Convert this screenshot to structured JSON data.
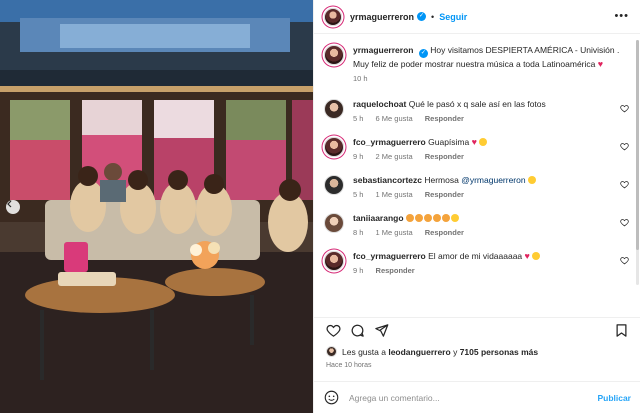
{
  "post": {
    "username": "yrmaguerreron",
    "follow_label": "Seguir",
    "dot": "•",
    "more": "•••"
  },
  "caption": {
    "username": "yrmaguerreron",
    "text": "Hoy visitamos DESPIERTA AMÉRICA - Univisión . Muy feliz de poder mostrar nuestra música a toda Latinoamérica",
    "time": "10 h"
  },
  "comments": [
    {
      "username": "raquelochoat",
      "text": "Qué le pasó x q sale así en las fotos",
      "time": "5 h",
      "likes": "6 Me gusta",
      "reply": "Responder"
    },
    {
      "username": "fco_yrmaguerrero",
      "text": "Guapísima",
      "time": "9 h",
      "likes": "2 Me gusta",
      "reply": "Responder"
    },
    {
      "username": "sebastiancortezc",
      "text": "Hermosa",
      "mention": "@yrmaguerreron",
      "time": "5 h",
      "likes": "1 Me gusta",
      "reply": "Responder"
    },
    {
      "username": "taniiaarango",
      "text": "",
      "time": "8 h",
      "likes": "1 Me gusta",
      "reply": "Responder"
    },
    {
      "username": "fco_yrmaguerrero",
      "text": "El amor de mi vidaaaaaa",
      "time": "9 h",
      "likes": "",
      "reply": "Responder"
    }
  ],
  "likes": {
    "prefix": "Les gusta a",
    "user": "leodanguerrero",
    "conj": "y",
    "count": "7105 personas más"
  },
  "posted_ago": "Hace 10 horas",
  "comment_box": {
    "placeholder": "Agrega un comentario...",
    "publish_label": "Publicar"
  },
  "colors": {
    "accent": "#0095f6",
    "heart": "#e0245e"
  },
  "icons": [
    "chevron-left-icon",
    "verified-badge-icon",
    "heart-icon",
    "comment-icon",
    "share-icon",
    "bookmark-icon",
    "emoji-icon"
  ]
}
